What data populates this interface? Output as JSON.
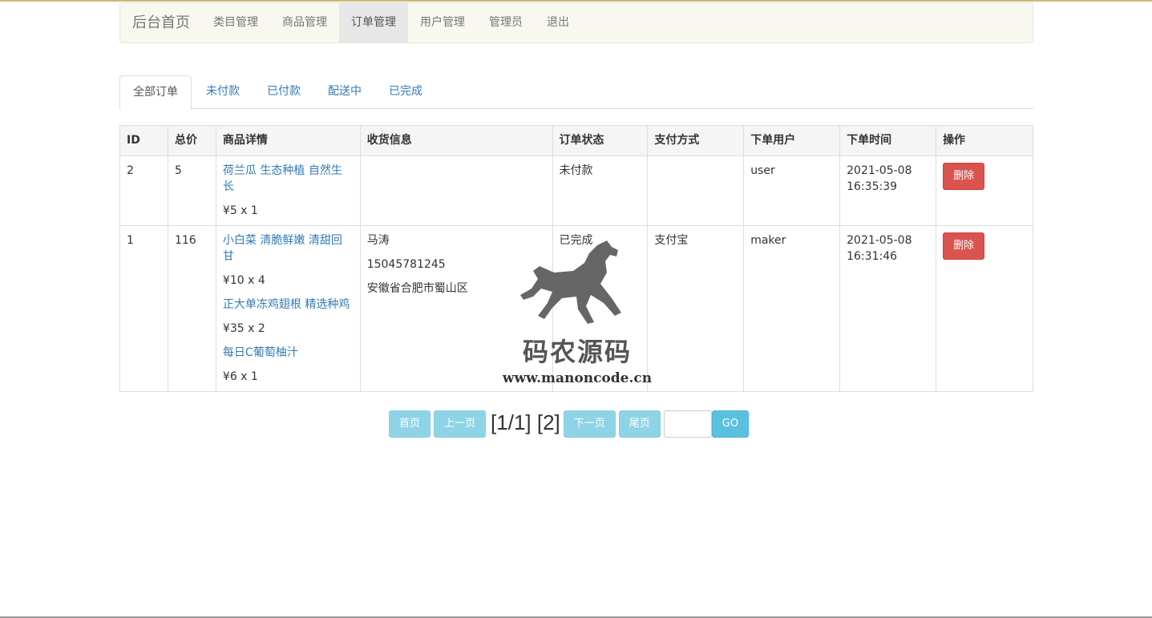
{
  "navbar": {
    "brand": "后台首页",
    "items": [
      "类目管理",
      "商品管理",
      "订单管理",
      "用户管理",
      "管理员",
      "退出"
    ],
    "active_index": 2
  },
  "tabs": {
    "items": [
      "全部订单",
      "未付款",
      "已付款",
      "配送中",
      "已完成"
    ],
    "active_index": 0
  },
  "table": {
    "headers": [
      "ID",
      "总价",
      "商品详情",
      "收货信息",
      "订单状态",
      "支付方式",
      "下单用户",
      "下单时间",
      "操作"
    ],
    "rows": [
      {
        "id": "2",
        "total": "5",
        "items": [
          {
            "name": "荷兰瓜 生态种植 自然生长",
            "price": "¥5 x 1"
          }
        ],
        "shipping": [],
        "status": "未付款",
        "payment": "",
        "user": "user",
        "date": "2021-05-08",
        "time": "16:35:39",
        "action": "删除"
      },
      {
        "id": "1",
        "total": "116",
        "items": [
          {
            "name": "小白菜 清脆鲜嫩 清甜回甘",
            "price": "¥10 x 4"
          },
          {
            "name": "正大单冻鸡翅根 精选种鸡",
            "price": "¥35 x 2"
          },
          {
            "name": "每日C葡萄柚汁",
            "price": "¥6 x 1"
          }
        ],
        "shipping": [
          "马涛",
          "15045781245",
          "安徽省合肥市蜀山区"
        ],
        "status": "已完成",
        "payment": "支付宝",
        "user": "maker",
        "date": "2021-05-08",
        "time": "16:31:46",
        "action": "删除"
      }
    ]
  },
  "pagination": {
    "first": "首页",
    "prev": "上一页",
    "info": "[1/1] [2]",
    "next": "下一页",
    "last": "尾页",
    "go": "GO",
    "input_value": ""
  },
  "watermark": {
    "text": "码农源码",
    "url": "www.manoncode.cn",
    "icon": "horse-logo"
  },
  "colors": {
    "link": "#337ab7",
    "danger": "#d9534f",
    "pager_disabled": "#8fd4e6",
    "pager_go": "#5bc0de"
  }
}
